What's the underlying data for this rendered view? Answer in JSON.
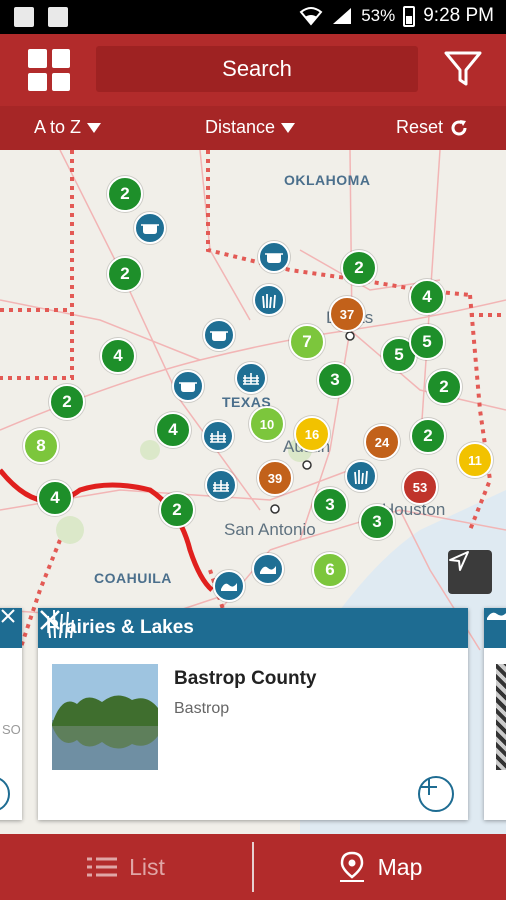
{
  "status_bar": {
    "battery": "53%",
    "time": "9:28 PM"
  },
  "header": {
    "search_label": "Search"
  },
  "sort_bar": {
    "alpha_label": "A to Z",
    "distance_label": "Distance",
    "reset_label": "Reset"
  },
  "map": {
    "region_labels": [
      "OKLAHOMA",
      "TEXAS",
      "COAHUILA"
    ],
    "city_labels": [
      "Austin",
      "San Antonio",
      "Houston",
      "Dallas"
    ],
    "clusters": [
      "2",
      "2",
      "4",
      "2",
      "8",
      "4",
      "4",
      "2",
      "10",
      "16",
      "39",
      "24",
      "2",
      "53",
      "11",
      "3",
      "3",
      "3",
      "6",
      "7",
      "37",
      "2",
      "4",
      "5",
      "5",
      "2"
    ]
  },
  "colors": {
    "brand_red": "#b22b2b",
    "card_blue": "#1e6c92",
    "green": "#1e8f2a",
    "orange": "#c2611a",
    "yellow": "#f2c200",
    "lime": "#7cc63c",
    "red_cluster": "#c0342b"
  },
  "cards": {
    "left_partial_text": "SO",
    "main": {
      "category": "Prairies & Lakes",
      "name": "Bastrop County",
      "location": "Bastrop"
    }
  },
  "bottom_bar": {
    "list_label": "List",
    "map_label": "Map"
  }
}
